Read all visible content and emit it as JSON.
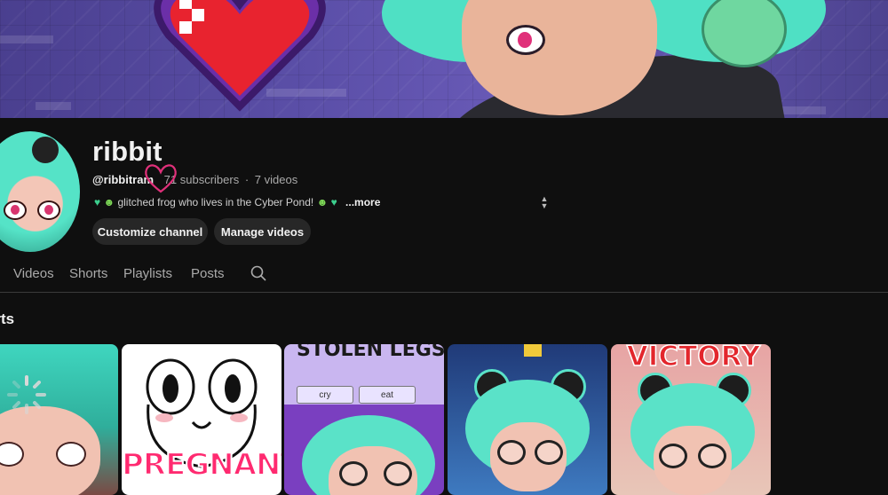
{
  "channel": {
    "name": "ribbit",
    "handle": "@ribbitram",
    "subscribers": "71 subscribers",
    "separator": "·",
    "videos": "7 videos",
    "description": "glitched frog who lives in the Cyber Pond!",
    "more_label": "...more"
  },
  "buttons": {
    "customize": "Customize channel",
    "manage": "Manage videos"
  },
  "tabs": [
    "Videos",
    "Shorts",
    "Playlists",
    "Posts"
  ],
  "section": {
    "title": "orts"
  },
  "shorts": [
    {
      "overlay": ""
    },
    {
      "overlay": "PREGNANT"
    },
    {
      "overlay": "STOLEN LEGS",
      "choices": [
        "cry",
        "eat"
      ]
    },
    {
      "overlay": ""
    },
    {
      "overlay": "VICTORY"
    }
  ],
  "colors": {
    "background": "#0f0f0f",
    "button_bg": "#272727",
    "text_primary": "#f1f1f1",
    "text_secondary": "#aaaaaa",
    "accent_heart": "#e0307a"
  },
  "icons": [
    "search-icon",
    "heart-icon",
    "loading-spinner-icon",
    "sort-arrows-icon",
    "heart-doodle-icon"
  ]
}
